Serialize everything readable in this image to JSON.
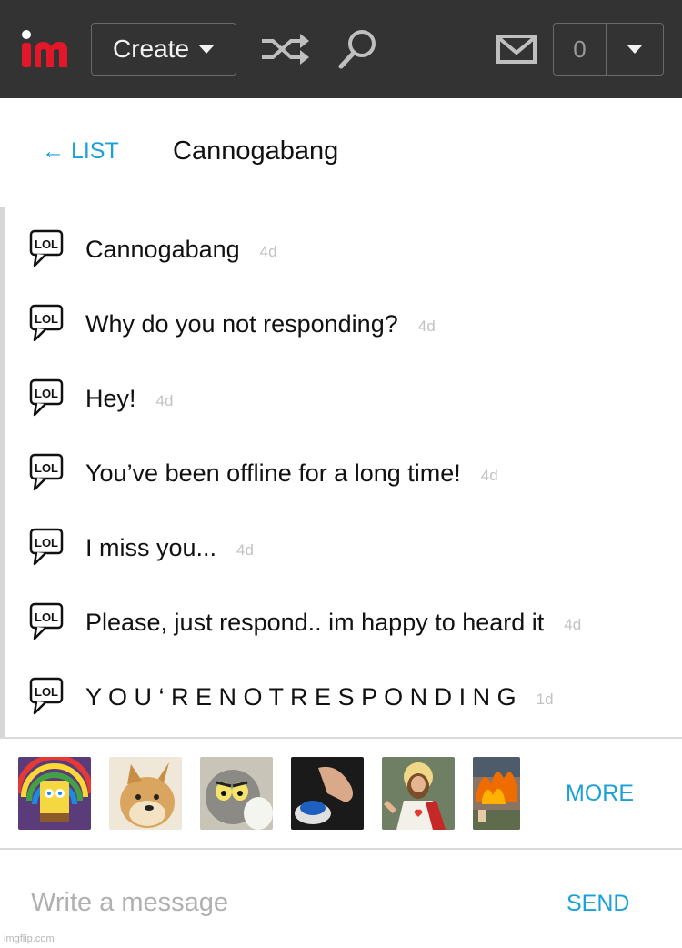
{
  "topbar": {
    "logo_text": "im",
    "create_label": "Create",
    "notification_count": "0",
    "colors": {
      "background": "#333333",
      "logo_red": "#e2172a",
      "icon": "#bfbfbf"
    },
    "icons": [
      "shuffle-icon",
      "search-icon",
      "mail-icon",
      "caret-down-icon"
    ]
  },
  "header": {
    "back_label": "← LIST",
    "conversation_title": "Cannogabang"
  },
  "messages": [
    {
      "icon": "lol-icon",
      "text": "Cannogabang",
      "time": "4d"
    },
    {
      "icon": "lol-icon",
      "text": "Why do you not responding?",
      "time": "4d"
    },
    {
      "icon": "lol-icon",
      "text": "Hey!",
      "time": "4d"
    },
    {
      "icon": "lol-icon",
      "text": "You’ve been offline for a long time!",
      "time": "4d"
    },
    {
      "icon": "lol-icon",
      "text": "I miss you...",
      "time": "4d"
    },
    {
      "icon": "lol-icon",
      "text": "Please, just respond.. im happy to heard it",
      "time": "4d"
    },
    {
      "icon": "lol-icon",
      "text": "Y O U ‘ R E N O T R E S P O N D I N G",
      "time": "1d"
    }
  ],
  "memes": {
    "thumbnails": [
      "imagination-spongebob",
      "doge",
      "unsettled-tom",
      "blank-nut-button",
      "buddy-christ",
      "disaster-girl"
    ],
    "more_label": "MORE"
  },
  "composer": {
    "placeholder": "Write a message",
    "send_label": "SEND"
  },
  "footer": {
    "watermark": "imgflip.com"
  },
  "accent_color": "#1ba0d8"
}
